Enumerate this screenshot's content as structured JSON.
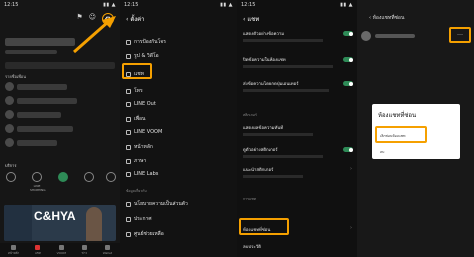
{
  "accent": "#f5a000",
  "toggle_color": "#2e8b57",
  "panel1": {
    "status_time": "12:15",
    "top_icons": [
      "bookmark-icon",
      "person-add-icon",
      "gear-icon"
    ],
    "friends_label": "รายชื่อเพื่อน",
    "services_label": "บริการ",
    "services": [
      {
        "label": "",
        "icon": "smile-icon"
      },
      {
        "label": "LINE SHOPPING",
        "icon": "bag-icon"
      },
      {
        "label": "",
        "icon": "coin-icon"
      },
      {
        "label": "",
        "icon": "shield-icon"
      },
      {
        "label": "",
        "icon": "gift-icon"
      }
    ],
    "banner_text": "C&HYA",
    "bottom_nav": [
      {
        "label": "หน้าหลัก"
      },
      {
        "label": "แชท"
      },
      {
        "label": "VOOM"
      },
      {
        "label": "ข่าว"
      },
      {
        "label": "Wallet"
      }
    ]
  },
  "panel2": {
    "status_time": "12:15",
    "title": "ตั้งค่า",
    "items": [
      {
        "label": "การป้องกันโจร"
      },
      {
        "label": "รูป & วิดีโอ"
      },
      {
        "label": "แชท"
      },
      {
        "label": "โทร"
      },
      {
        "label": "LINE Out"
      },
      {
        "label": "เพื่อน"
      },
      {
        "label": "LINE VOOM"
      },
      {
        "label": "หน้าหลัก"
      },
      {
        "label": "ภาษา"
      },
      {
        "label": "LINE Labs"
      }
    ],
    "section2": "ข้อมูลเกี่ยวกับ",
    "items2": [
      {
        "label": "นโยบายความเป็นส่วนตัว"
      },
      {
        "label": "ประกาศ"
      },
      {
        "label": "ศูนย์ช่วยเหลือ"
      }
    ]
  },
  "panel3": {
    "status_time": "12:15",
    "title": "แชท",
    "rows": [
      {
        "title": "แสดงตัวอย่างข้อความ",
        "sub": "",
        "toggle": true
      },
      {
        "title": "ปิดข้อความในห้องแชท",
        "sub": "",
        "toggle": true
      },
      {
        "title": "ส่งข้อความโดยกดปุ่มเอนเทอร์",
        "sub": "",
        "toggle": true
      },
      {
        "title": "แสดงผลข้อความทันที",
        "sub": "",
        "toggle": false
      },
      {
        "title": "ดูตัวอย่างสติกเกอร์",
        "sub": "",
        "toggle": true
      },
      {
        "title": "แนะนำสติกเกอร์",
        "sub": "",
        "toggle": false
      },
      {
        "title": "ห้องแชทที่ซ่อน",
        "sub": "",
        "toggle": false
      },
      {
        "title": "ลบประวัติ",
        "sub": "",
        "toggle": false
      }
    ],
    "section_labels": [
      "สติกเกอร์",
      "การแชท"
    ]
  },
  "panel4": {
    "title": "ห้องแชทที่ซ่อน",
    "chat_name": "",
    "dialog": {
      "title": "ห้องแชทที่ซ่อน",
      "options": [
        "เลิกซ่อนห้องแชท",
        "ลบ"
      ]
    }
  }
}
